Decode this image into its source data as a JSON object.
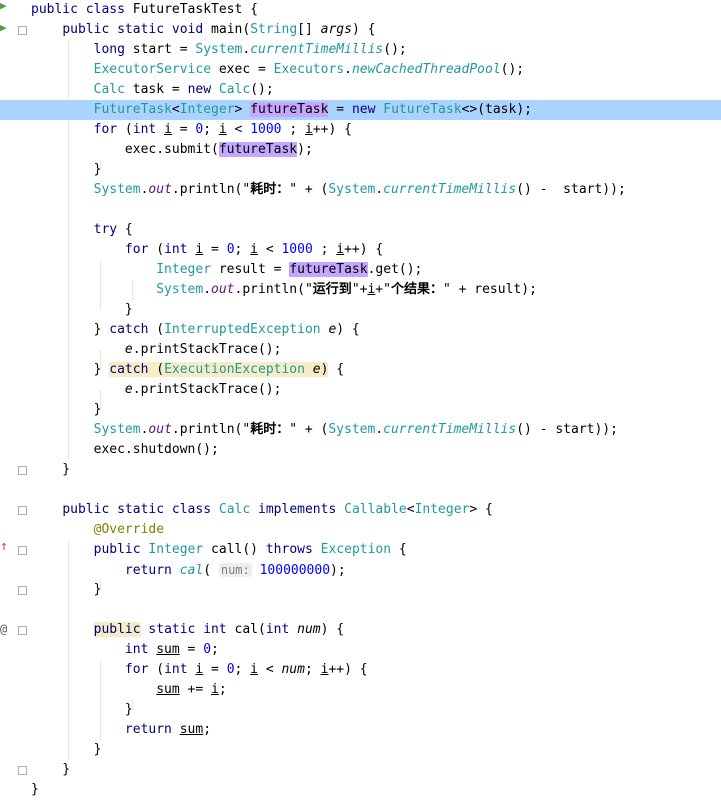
{
  "editor": {
    "lines": [
      "public class FutureTaskTest {",
      "    public static void main(String[] args) {",
      "        long start = System.currentTimeMillis();",
      "        ExecutorService exec = Executors.newCachedThreadPool();",
      "        Calc task = new Calc();",
      "        FutureTask<Integer> futureTask = new FutureTask<>(task);",
      "        for (int i = 0; i < 1000 ; i++) {",
      "            exec.submit(futureTask);",
      "        }",
      "        System.out.println(\"耗时：\" + (System.currentTimeMillis() -  start));",
      "",
      "        try {",
      "            for (int i = 0; i < 1000 ; i++) {",
      "                Integer result = futureTask.get();",
      "                System.out.println(\"运行到\"+i+\"个结果：\" + result);",
      "            }",
      "        } catch (InterruptedException e) {",
      "            e.printStackTrace();",
      "        } catch (ExecutionException e) {",
      "            e.printStackTrace();",
      "        }",
      "        System.out.println(\"耗时：\" + (System.currentTimeMillis() - start));",
      "        exec.shutdown();",
      "    }",
      "",
      "    public static class Calc implements Callable<Integer> {",
      "        @Override",
      "        public Integer call() throws Exception {",
      "            return cal( num: 100000000);",
      "        }",
      "",
      "        public static int cal(int num) {",
      "            int sum = 0;",
      "            for (int i = 0; i < num; i++) {",
      "                sum += i;",
      "            }",
      "            return sum;",
      "        }",
      "    }",
      "}"
    ],
    "caret_line": 6,
    "parameter_hint": "num:",
    "colors": {
      "caret_row": "#aad3ff",
      "highlight_purple": "#c5a7ff",
      "highlight_yellow": "#f7edc5",
      "keyword": "#000080",
      "type": "#20999d",
      "string": "#008000",
      "annotation": "#808000"
    },
    "gutter_icons": [
      "run-icon",
      "run-icon",
      "override-up-arrow-icon",
      "at-sign-icon"
    ]
  }
}
